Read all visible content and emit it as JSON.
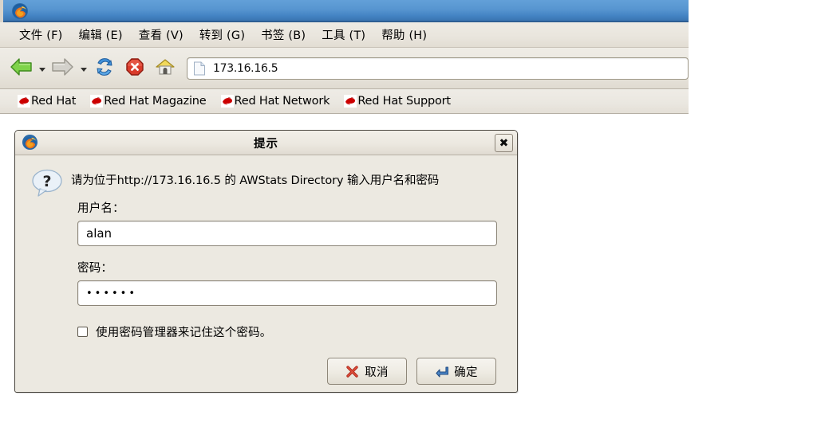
{
  "window": {
    "titlebar_color": "#4484c4",
    "app_icon": "firefox-icon"
  },
  "menubar": {
    "items": [
      {
        "label": "文件 (F)",
        "name": "menu-file"
      },
      {
        "label": "编辑 (E)",
        "name": "menu-edit"
      },
      {
        "label": "查看 (V)",
        "name": "menu-view"
      },
      {
        "label": "转到 (G)",
        "name": "menu-go"
      },
      {
        "label": "书签 (B)",
        "name": "menu-bookmarks"
      },
      {
        "label": "工具 (T)",
        "name": "menu-tools"
      },
      {
        "label": "帮助 (H)",
        "name": "menu-help"
      }
    ]
  },
  "toolbar": {
    "back_icon": "back-arrow-icon",
    "forward_icon": "forward-arrow-icon",
    "reload_icon": "reload-icon",
    "stop_icon": "stop-icon",
    "home_icon": "home-icon",
    "url_value": "173.16.16.5",
    "url_placeholder": "",
    "url_favicon": "page-icon"
  },
  "bookmarks": {
    "items": [
      {
        "label": "Red Hat",
        "icon": "redhat-icon"
      },
      {
        "label": "Red Hat Magazine",
        "icon": "redhat-icon"
      },
      {
        "label": "Red Hat Network",
        "icon": "redhat-icon"
      },
      {
        "label": "Red Hat Support",
        "icon": "redhat-icon"
      }
    ]
  },
  "dialog": {
    "title": "提示",
    "icon": "firefox-icon",
    "close_label": "✖",
    "message_icon": "question-bubble-icon",
    "message": "请为位于http://173.16.16.5 的 AWStats Directory 输入用户名和密码",
    "username": {
      "label": "用户名：",
      "value": "alan",
      "placeholder": ""
    },
    "password": {
      "label": "密码：",
      "value": "••••••",
      "placeholder": ""
    },
    "remember": {
      "label": "使用密码管理器来记住这个密码。",
      "checked": false
    },
    "buttons": {
      "cancel": {
        "label": "取消",
        "icon": "cancel-x-icon"
      },
      "ok": {
        "label": "确定",
        "icon": "enter-arrow-icon"
      }
    }
  }
}
